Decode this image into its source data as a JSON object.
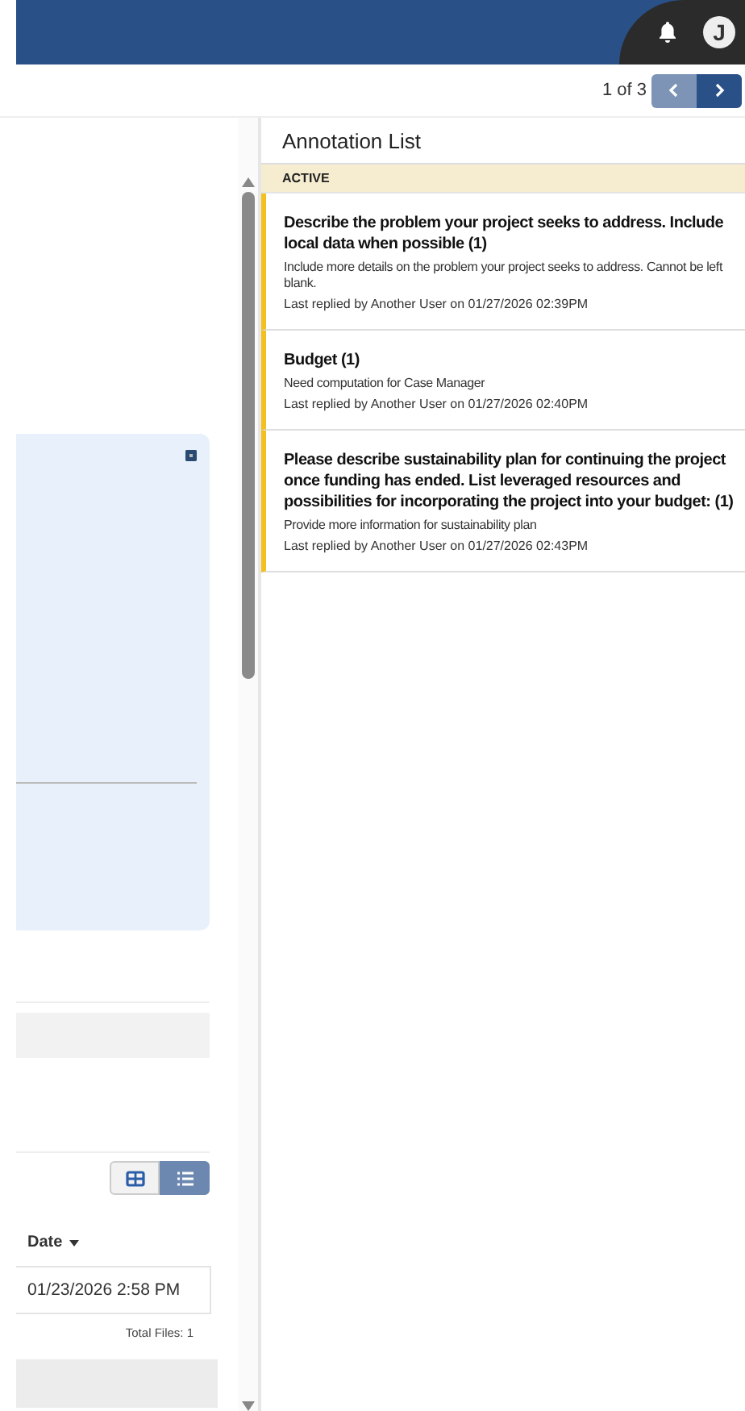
{
  "header": {
    "avatar_initial": "J"
  },
  "pager": {
    "text": "1 of 3",
    "prev_disabled": true,
    "next_disabled": false
  },
  "view_toggle": [
    {
      "kind": "grid",
      "selected": false
    },
    {
      "kind": "list",
      "selected": true
    }
  ],
  "files_table": {
    "columns": [
      {
        "label": "Date",
        "sorted": true
      }
    ],
    "rows": [
      {
        "date": "01/23/2026 2:58 PM"
      }
    ],
    "total": "Total Files: 1"
  },
  "annotation_list": {
    "title": "Annotation List",
    "section": "ACTIVE",
    "items": [
      {
        "title": "Describe the problem your project seeks to address. Include local data when possible (1)",
        "body": "Include more details on the problem your project seeks to address. Cannot be left blank.",
        "meta": "Last replied by Another User on 01/27/2026 02:39PM"
      },
      {
        "title": "Budget (1)",
        "body": "Need computation for Case Manager",
        "meta": "Last replied by Another User on 01/27/2026 02:40PM"
      },
      {
        "title": "Please describe sustainability plan for continuing the project once funding has ended. List leveraged resources and possibilities for incorporating the project into your budget: (1)",
        "body": "Provide more information for sustainability plan",
        "meta": "Last replied by Another User on 01/27/2026 02:43PM"
      }
    ]
  }
}
